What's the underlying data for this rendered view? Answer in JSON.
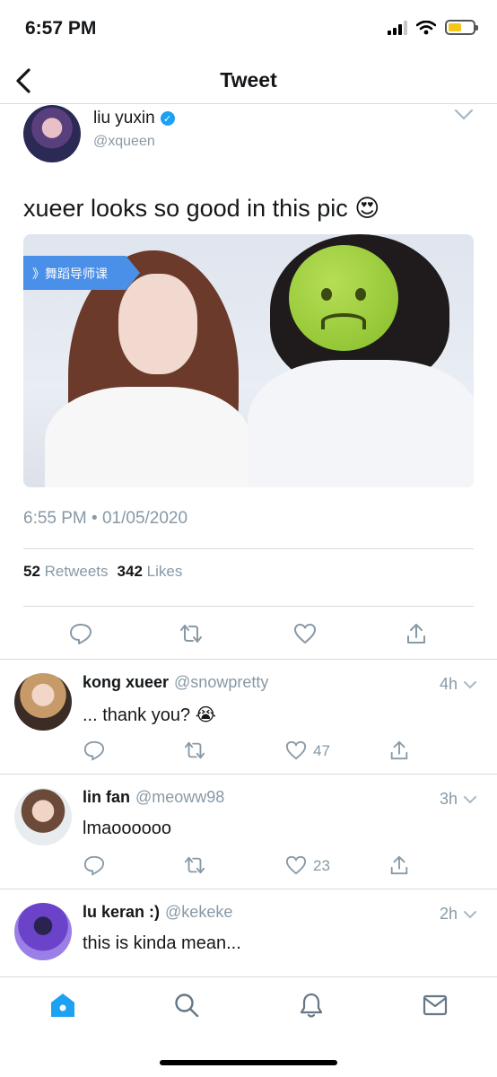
{
  "status_bar": {
    "time": "6:57 PM"
  },
  "nav": {
    "title": "Tweet"
  },
  "tweet": {
    "author_name": "liu yuxin",
    "author_handle": "@xqueen",
    "text": "xueer looks so good in this pic 😍",
    "media_banner": "》舞蹈导师课",
    "timestamp": "6:55 PM • 01/05/2020",
    "retweets_count": "52",
    "retweets_label": "Retweets",
    "likes_count": "342",
    "likes_label": "Likes"
  },
  "replies": [
    {
      "name": "kong xueer",
      "handle": "@snowpretty",
      "time": "4h",
      "text": "... thank you? 😭",
      "likes": "47"
    },
    {
      "name": "lin fan",
      "handle": "@meoww98",
      "time": "3h",
      "text": "lmaoooooo",
      "likes": "23"
    },
    {
      "name": "lu keran :)",
      "handle": "@kekeke",
      "time": "2h",
      "text": "this is kinda mean...",
      "likes": ""
    }
  ],
  "colors": {
    "accent": "#1da1f2",
    "muted": "#8899a6",
    "divider": "#d6dadd"
  },
  "tabs": [
    "home-icon",
    "search-icon",
    "notifications-icon",
    "messages-icon"
  ]
}
